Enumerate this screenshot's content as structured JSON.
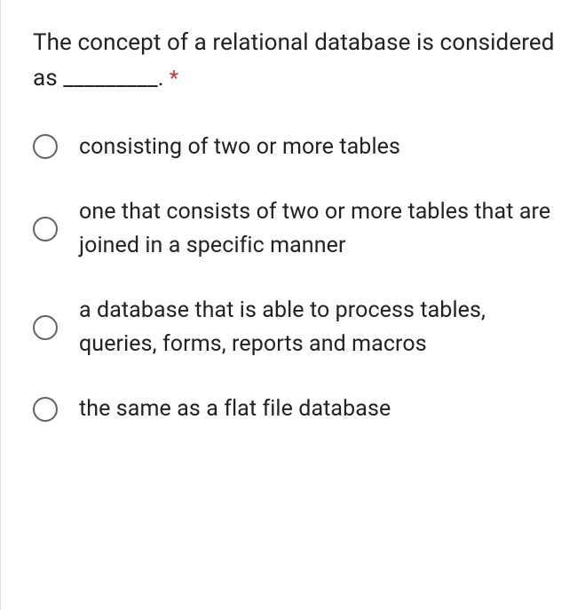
{
  "question": {
    "text": "The concept of a relational database is considered as _________.",
    "required_marker": "*"
  },
  "options": [
    {
      "label": "consisting of two or more tables"
    },
    {
      "label": "one that consists of two or more tables that are joined in a specific manner"
    },
    {
      "label": "a database that is able to process tables, queries, forms, reports and macros"
    },
    {
      "label": "the same as a flat file database"
    }
  ]
}
